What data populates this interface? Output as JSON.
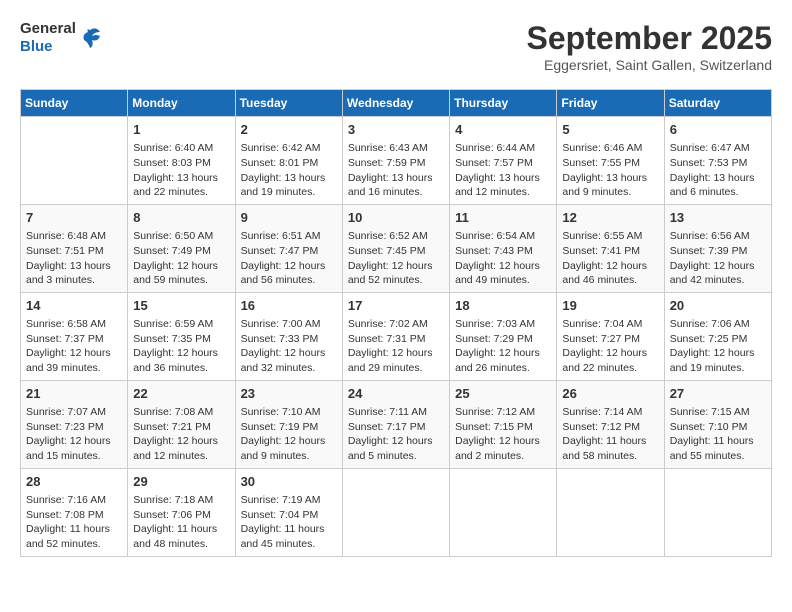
{
  "logo": {
    "line1": "General",
    "line2": "Blue"
  },
  "title": "September 2025",
  "location": "Eggersriet, Saint Gallen, Switzerland",
  "weekdays": [
    "Sunday",
    "Monday",
    "Tuesday",
    "Wednesday",
    "Thursday",
    "Friday",
    "Saturday"
  ],
  "weeks": [
    [
      {
        "day": "",
        "sunrise": "",
        "sunset": "",
        "daylight": ""
      },
      {
        "day": "1",
        "sunrise": "Sunrise: 6:40 AM",
        "sunset": "Sunset: 8:03 PM",
        "daylight": "Daylight: 13 hours and 22 minutes."
      },
      {
        "day": "2",
        "sunrise": "Sunrise: 6:42 AM",
        "sunset": "Sunset: 8:01 PM",
        "daylight": "Daylight: 13 hours and 19 minutes."
      },
      {
        "day": "3",
        "sunrise": "Sunrise: 6:43 AM",
        "sunset": "Sunset: 7:59 PM",
        "daylight": "Daylight: 13 hours and 16 minutes."
      },
      {
        "day": "4",
        "sunrise": "Sunrise: 6:44 AM",
        "sunset": "Sunset: 7:57 PM",
        "daylight": "Daylight: 13 hours and 12 minutes."
      },
      {
        "day": "5",
        "sunrise": "Sunrise: 6:46 AM",
        "sunset": "Sunset: 7:55 PM",
        "daylight": "Daylight: 13 hours and 9 minutes."
      },
      {
        "day": "6",
        "sunrise": "Sunrise: 6:47 AM",
        "sunset": "Sunset: 7:53 PM",
        "daylight": "Daylight: 13 hours and 6 minutes."
      }
    ],
    [
      {
        "day": "7",
        "sunrise": "Sunrise: 6:48 AM",
        "sunset": "Sunset: 7:51 PM",
        "daylight": "Daylight: 13 hours and 3 minutes."
      },
      {
        "day": "8",
        "sunrise": "Sunrise: 6:50 AM",
        "sunset": "Sunset: 7:49 PM",
        "daylight": "Daylight: 12 hours and 59 minutes."
      },
      {
        "day": "9",
        "sunrise": "Sunrise: 6:51 AM",
        "sunset": "Sunset: 7:47 PM",
        "daylight": "Daylight: 12 hours and 56 minutes."
      },
      {
        "day": "10",
        "sunrise": "Sunrise: 6:52 AM",
        "sunset": "Sunset: 7:45 PM",
        "daylight": "Daylight: 12 hours and 52 minutes."
      },
      {
        "day": "11",
        "sunrise": "Sunrise: 6:54 AM",
        "sunset": "Sunset: 7:43 PM",
        "daylight": "Daylight: 12 hours and 49 minutes."
      },
      {
        "day": "12",
        "sunrise": "Sunrise: 6:55 AM",
        "sunset": "Sunset: 7:41 PM",
        "daylight": "Daylight: 12 hours and 46 minutes."
      },
      {
        "day": "13",
        "sunrise": "Sunrise: 6:56 AM",
        "sunset": "Sunset: 7:39 PM",
        "daylight": "Daylight: 12 hours and 42 minutes."
      }
    ],
    [
      {
        "day": "14",
        "sunrise": "Sunrise: 6:58 AM",
        "sunset": "Sunset: 7:37 PM",
        "daylight": "Daylight: 12 hours and 39 minutes."
      },
      {
        "day": "15",
        "sunrise": "Sunrise: 6:59 AM",
        "sunset": "Sunset: 7:35 PM",
        "daylight": "Daylight: 12 hours and 36 minutes."
      },
      {
        "day": "16",
        "sunrise": "Sunrise: 7:00 AM",
        "sunset": "Sunset: 7:33 PM",
        "daylight": "Daylight: 12 hours and 32 minutes."
      },
      {
        "day": "17",
        "sunrise": "Sunrise: 7:02 AM",
        "sunset": "Sunset: 7:31 PM",
        "daylight": "Daylight: 12 hours and 29 minutes."
      },
      {
        "day": "18",
        "sunrise": "Sunrise: 7:03 AM",
        "sunset": "Sunset: 7:29 PM",
        "daylight": "Daylight: 12 hours and 26 minutes."
      },
      {
        "day": "19",
        "sunrise": "Sunrise: 7:04 AM",
        "sunset": "Sunset: 7:27 PM",
        "daylight": "Daylight: 12 hours and 22 minutes."
      },
      {
        "day": "20",
        "sunrise": "Sunrise: 7:06 AM",
        "sunset": "Sunset: 7:25 PM",
        "daylight": "Daylight: 12 hours and 19 minutes."
      }
    ],
    [
      {
        "day": "21",
        "sunrise": "Sunrise: 7:07 AM",
        "sunset": "Sunset: 7:23 PM",
        "daylight": "Daylight: 12 hours and 15 minutes."
      },
      {
        "day": "22",
        "sunrise": "Sunrise: 7:08 AM",
        "sunset": "Sunset: 7:21 PM",
        "daylight": "Daylight: 12 hours and 12 minutes."
      },
      {
        "day": "23",
        "sunrise": "Sunrise: 7:10 AM",
        "sunset": "Sunset: 7:19 PM",
        "daylight": "Daylight: 12 hours and 9 minutes."
      },
      {
        "day": "24",
        "sunrise": "Sunrise: 7:11 AM",
        "sunset": "Sunset: 7:17 PM",
        "daylight": "Daylight: 12 hours and 5 minutes."
      },
      {
        "day": "25",
        "sunrise": "Sunrise: 7:12 AM",
        "sunset": "Sunset: 7:15 PM",
        "daylight": "Daylight: 12 hours and 2 minutes."
      },
      {
        "day": "26",
        "sunrise": "Sunrise: 7:14 AM",
        "sunset": "Sunset: 7:12 PM",
        "daylight": "Daylight: 11 hours and 58 minutes."
      },
      {
        "day": "27",
        "sunrise": "Sunrise: 7:15 AM",
        "sunset": "Sunset: 7:10 PM",
        "daylight": "Daylight: 11 hours and 55 minutes."
      }
    ],
    [
      {
        "day": "28",
        "sunrise": "Sunrise: 7:16 AM",
        "sunset": "Sunset: 7:08 PM",
        "daylight": "Daylight: 11 hours and 52 minutes."
      },
      {
        "day": "29",
        "sunrise": "Sunrise: 7:18 AM",
        "sunset": "Sunset: 7:06 PM",
        "daylight": "Daylight: 11 hours and 48 minutes."
      },
      {
        "day": "30",
        "sunrise": "Sunrise: 7:19 AM",
        "sunset": "Sunset: 7:04 PM",
        "daylight": "Daylight: 11 hours and 45 minutes."
      },
      {
        "day": "",
        "sunrise": "",
        "sunset": "",
        "daylight": ""
      },
      {
        "day": "",
        "sunrise": "",
        "sunset": "",
        "daylight": ""
      },
      {
        "day": "",
        "sunrise": "",
        "sunset": "",
        "daylight": ""
      },
      {
        "day": "",
        "sunrise": "",
        "sunset": "",
        "daylight": ""
      }
    ]
  ]
}
